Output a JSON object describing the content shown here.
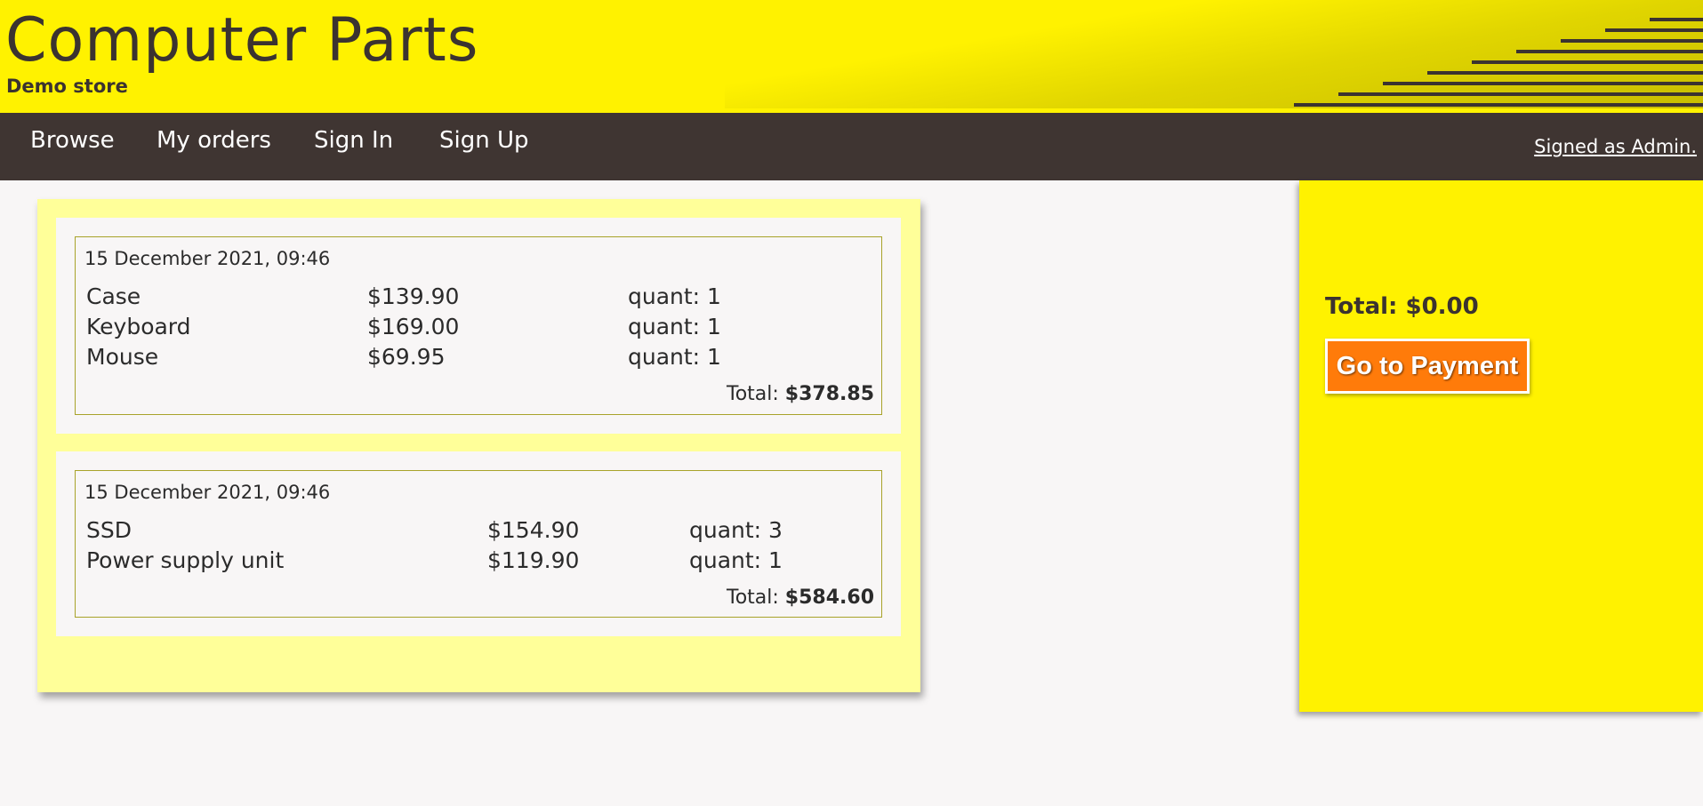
{
  "header": {
    "title": "Computer Parts",
    "subtitle": "Demo store"
  },
  "nav": {
    "items": [
      {
        "label": "Browse"
      },
      {
        "label": "My orders"
      },
      {
        "label": "Sign In"
      },
      {
        "label": "Sign Up"
      }
    ],
    "signed_as": "Signed as Admin."
  },
  "orders": [
    {
      "date": "15 December 2021, 09:46",
      "items": [
        {
          "name": "Case",
          "price": "$139.90",
          "quantity": "quant: 1"
        },
        {
          "name": "Keyboard",
          "price": "$169.00",
          "quantity": "quant: 1"
        },
        {
          "name": "Mouse",
          "price": "$69.95",
          "quantity": "quant: 1"
        }
      ],
      "total_label": "Total:",
      "total_value": "$378.85"
    },
    {
      "date": "15 December 2021, 09:46",
      "items": [
        {
          "name": "SSD",
          "price": "$154.90",
          "quantity": "quant: 3"
        },
        {
          "name": "Power supply unit",
          "price": "$119.90",
          "quantity": "quant: 1"
        }
      ],
      "total_label": "Total:",
      "total_value": "$584.60"
    }
  ],
  "cart": {
    "total": "Total: $0.00",
    "payment_button": "Go to Payment"
  },
  "colors": {
    "brand_yellow": "#fff200",
    "nav_dark": "#3f3532",
    "panel_light_yellow": "#ffff99",
    "payment_orange": "#ff7b0a"
  }
}
